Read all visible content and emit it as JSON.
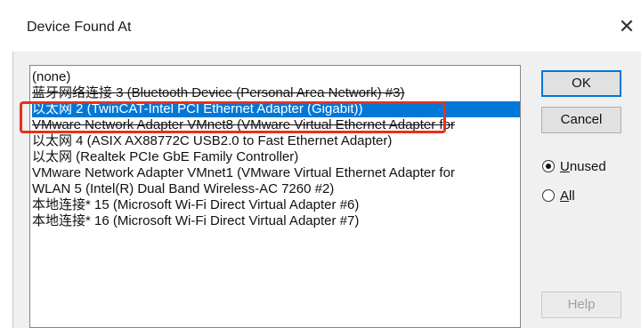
{
  "window": {
    "title": "Device Found At",
    "close_glyph": "✕"
  },
  "list": {
    "selected_index": 2,
    "items": [
      "(none)",
      "蓝牙网络连接 3 (Bluetooth Device (Personal Area Network) #3)",
      "以太网 2 (TwinCAT-Intel PCI Ethernet Adapter (Gigabit))",
      "VMware Network Adapter VMnet8 (VMware Virtual Ethernet Adapter for",
      "以太网 4 (ASIX AX88772C USB2.0 to Fast Ethernet Adapter)",
      "以太网 (Realtek PCIe GbE Family Controller)",
      "VMware Network Adapter VMnet1 (VMware Virtual Ethernet Adapter for",
      "WLAN 5 (Intel(R) Dual Band Wireless-AC 7260 #2)",
      "本地连接* 15 (Microsoft Wi-Fi Direct Virtual Adapter #6)",
      "本地连接* 16 (Microsoft Wi-Fi Direct Virtual Adapter #7)"
    ]
  },
  "buttons": {
    "ok": "OK",
    "cancel": "Cancel",
    "help": "Help"
  },
  "radios": {
    "unused": {
      "label_first": "U",
      "label_rest": "nused",
      "checked": true
    },
    "all": {
      "label_first": "A",
      "label_rest": "ll",
      "checked": false
    }
  },
  "colors": {
    "selection": "#0078d7",
    "highlight_box": "#e8301c"
  }
}
